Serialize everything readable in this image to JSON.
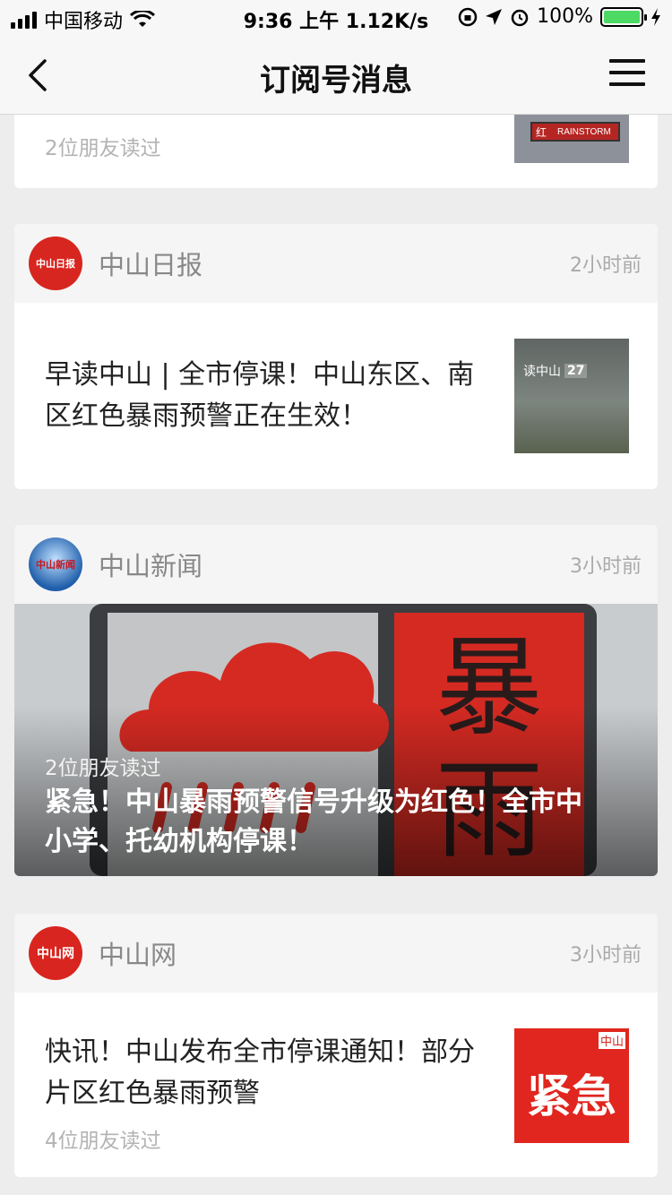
{
  "status_bar": {
    "carrier": "中国移动",
    "time": "9:36 上午",
    "network_speed": "1.12K/s",
    "battery_percent": "100%",
    "battery_level": 1.0
  },
  "nav": {
    "title": "订阅号消息"
  },
  "top_card": {
    "friends_read": "2位朋友读过",
    "thumb_text_left": "红",
    "thumb_text_right": "RAINSTORM"
  },
  "cards": [
    {
      "source": "中山日报",
      "time": "2小时前",
      "logo_text": "中山日报",
      "title": "早读中山 | 全市停课！中山东区、南区红色暴雨预警正在生效！",
      "thumb_text": "读中山",
      "thumb_number": "27"
    },
    {
      "source": "中山新闻",
      "time": "3小时前",
      "logo_text": "中山新闻",
      "friends_read": "2位朋友读过",
      "title": "紧急！中山暴雨预警信号升级为红色！全市中小学、托幼机构停课！",
      "banner_char_1": "暴",
      "banner_char_2": "雨"
    },
    {
      "source": "中山网",
      "time": "3小时前",
      "logo_text": "中山网",
      "title": "快讯！中山发布全市停课通知！部分片区红色暴雨预警",
      "friends_read": "4位朋友读过",
      "thumb_text": "紧急",
      "thumb_small": "中山"
    }
  ]
}
